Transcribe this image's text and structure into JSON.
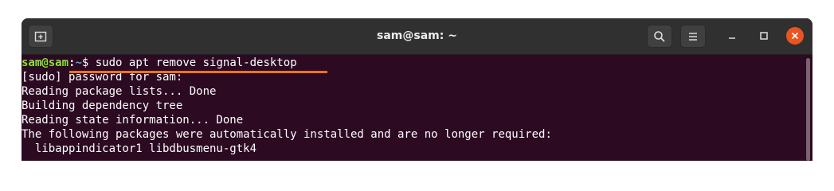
{
  "window": {
    "title": "sam@sam: ~"
  },
  "toolbar": {
    "new_tab_icon": "new-tab-icon",
    "search_icon": "search-icon",
    "menu_icon": "hamburger-menu-icon",
    "minimize_icon": "minimize-icon",
    "maximize_icon": "maximize-icon",
    "close_icon": "close-icon"
  },
  "colors": {
    "terminal_bg": "#2c0a22",
    "titlebar_bg": "#303030",
    "prompt_user": "#8ae234",
    "prompt_path": "#729fcf",
    "highlight_underline": "#f07219",
    "close_button": "#e95420"
  },
  "terminal": {
    "prompt": {
      "user_host": "sam@sam",
      "separator": ":",
      "path": "~",
      "symbol": "$",
      "command": " sudo apt remove signal-desktop"
    },
    "output": [
      "[sudo] password for sam:",
      "Reading package lists... Done",
      "Building dependency tree",
      "Reading state information... Done",
      "The following packages were automatically installed and are no longer required:",
      "  libappindicator1 libdbusmenu-gtk4"
    ]
  }
}
